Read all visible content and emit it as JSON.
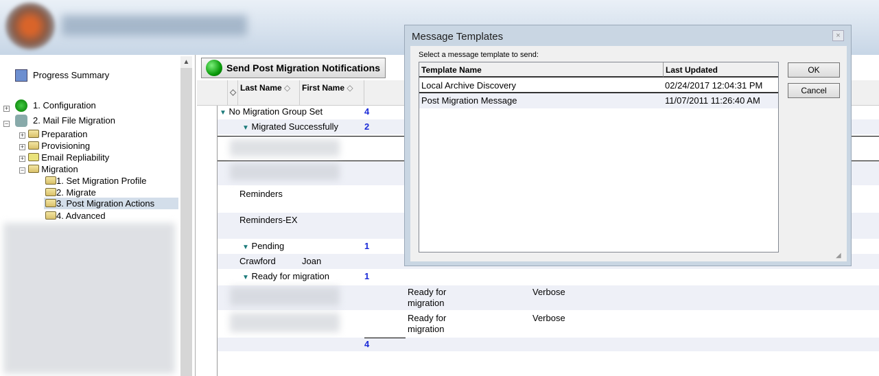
{
  "sidebar": {
    "progress_summary": "Progress Summary",
    "items": [
      {
        "label": "1. Configuration"
      },
      {
        "label": "2. Mail File Migration"
      },
      {
        "label": "Preparation"
      },
      {
        "label": "Provisioning"
      },
      {
        "label": "Email Repliability"
      },
      {
        "label": "Migration"
      },
      {
        "label": "1. Set Migration Profile"
      },
      {
        "label": "2. Migrate"
      },
      {
        "label": "3. Post Migration Actions"
      },
      {
        "label": "4. Advanced"
      }
    ]
  },
  "main": {
    "send_button": "Send Post Migration Notifications",
    "columns": [
      "Last Name",
      "First Name"
    ],
    "groups": {
      "g1": "No Migration Group Set",
      "g1_count": "4",
      "g2": "Migrated Successfully",
      "g2_count": "2",
      "g3": "Pending",
      "g3_count": "1",
      "g4": "Ready for migration",
      "g4_count": "1"
    },
    "rows": {
      "reminders": "Reminders",
      "reminders_ex": "Reminders-EX",
      "crawford_last": "Crawford",
      "crawford_first": "Joan",
      "status1": "Ready for migration",
      "level1": "Verbose",
      "status2": "Ready for migration",
      "level2": "Verbose"
    },
    "total": "4"
  },
  "dialog": {
    "title": "Message Templates",
    "close": "×",
    "prompt": "Select a message template to send:",
    "columns": [
      "Template Name",
      "Last Updated"
    ],
    "rows": [
      {
        "name": "Local Archive Discovery",
        "updated": "02/24/2017 12:04:31 PM"
      },
      {
        "name": "Post Migration Message",
        "updated": "11/07/2011 11:26:40 AM"
      }
    ],
    "ok": "OK",
    "cancel": "Cancel"
  }
}
